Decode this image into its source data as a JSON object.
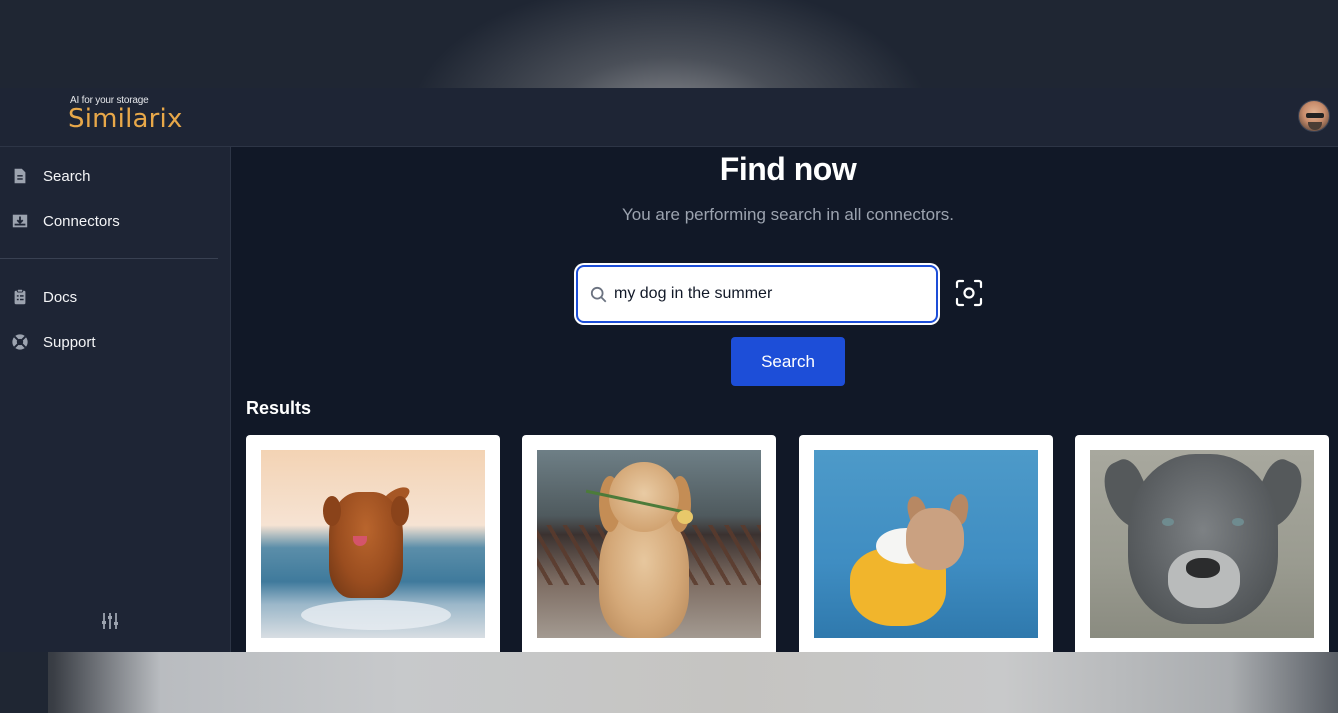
{
  "header": {
    "tagline": "AI for your storage",
    "logo": "Similarix"
  },
  "sidebar": {
    "items": [
      {
        "label": "Search",
        "icon": "document-icon"
      },
      {
        "label": "Connectors",
        "icon": "inbox-download-icon"
      },
      {
        "label": "Docs",
        "icon": "clipboard-icon"
      },
      {
        "label": "Support",
        "icon": "lifebuoy-icon"
      }
    ],
    "settings_icon": "sliders-icon"
  },
  "main": {
    "title": "Find now",
    "subtitle": "You are performing search in all connectors.",
    "search": {
      "value": "my dog in the summer",
      "placeholder": ""
    },
    "search_button": "Search",
    "results_label": "Results"
  },
  "colors": {
    "accent": "#1d4ed8",
    "logo": "#e8a849",
    "background": "#111827",
    "panel": "#1e2535"
  }
}
